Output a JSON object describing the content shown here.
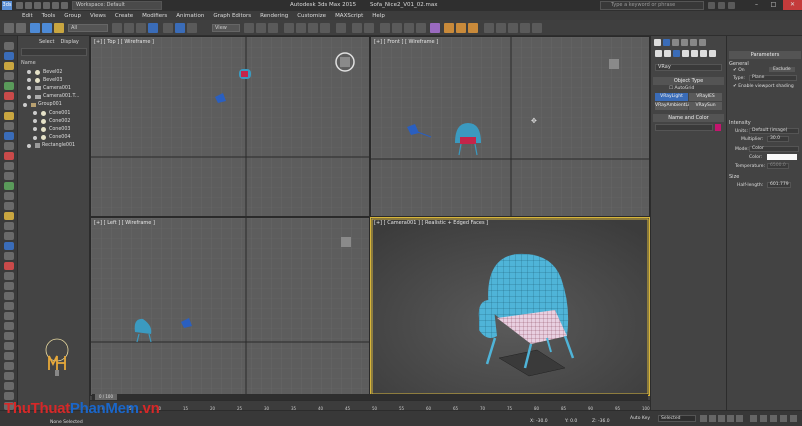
{
  "titlebar": {
    "app_logo": "3ds",
    "workspace": "Workspace: Default",
    "app_title": "Autodesk 3ds Max  2015",
    "file_title": "Sofa_Nice2_V01_02.max",
    "search_placeholder": "Type a keyword or phrase",
    "minimize": "–",
    "maximize": "□",
    "close": "✕"
  },
  "menu": [
    "Edit",
    "Tools",
    "Group",
    "Views",
    "Create",
    "Modifiers",
    "Animation",
    "Graph Editors",
    "Rendering",
    "Customize",
    "MAXScript",
    "Help"
  ],
  "toolbar": {
    "selection_filter": "All",
    "ref_coord": "View"
  },
  "scene_explorer": {
    "tabs": [
      "Select",
      "Display"
    ],
    "header": "Name",
    "items": [
      {
        "name": "Bevel02",
        "type": "light"
      },
      {
        "name": "Bevel03",
        "type": "light"
      },
      {
        "name": "Camera001",
        "type": "camera"
      },
      {
        "name": "Camera001.T...",
        "type": "camera"
      },
      {
        "name": "Group001",
        "type": "group"
      },
      {
        "name": "Cone001",
        "type": "light"
      },
      {
        "name": "Cone002",
        "type": "light"
      },
      {
        "name": "Cone003",
        "type": "light"
      },
      {
        "name": "Cone004",
        "type": "light"
      },
      {
        "name": "Rectangle001",
        "type": "object"
      }
    ]
  },
  "viewports": {
    "top": "[+] [ Top ] [ Wireframe ]",
    "front": "[+] [ Front ] [ Wireframe ]",
    "left": "[+] [ Left ] [ Wireframe ]",
    "camera": "[+] [ Camera001 ] [ Realistic + Edged Faces ]"
  },
  "command_panel": {
    "category": "VRay",
    "object_type_title": "Object Type",
    "autogrid": "AutoGrid",
    "buttons": [
      "VRayLight",
      "VRayIES",
      "VRayAmbientLig",
      "VRaySun"
    ],
    "name_color_title": "Name and Color",
    "colors": {
      "swatch": "#c4156e",
      "selected": "#3a6cb8",
      "frame": "#d8b63a"
    }
  },
  "parameters": {
    "title": "Parameters",
    "general": "General",
    "on_label": "On",
    "exclude": "Exclude",
    "type_label": "Type:",
    "type_value": "Plane",
    "viewport_shading": "Enable viewport shading",
    "intensity": "Intensity",
    "units_label": "Units:",
    "units_value": "Default (image)",
    "multiplier_label": "Multiplier:",
    "multiplier_value": "30.0",
    "mode_label": "Mode:",
    "mode_value": "Color",
    "color_label": "Color:",
    "temperature_label": "Temperature:",
    "temperature_value": "6500.0",
    "size": "Size",
    "half_length_label": "Half-length:",
    "half_length_value": "601.779"
  },
  "timeline": {
    "frame": "0 / 100",
    "ticks": [
      "0",
      "5",
      "10",
      "15",
      "20",
      "25",
      "30",
      "35",
      "40",
      "45",
      "50",
      "55",
      "60",
      "65",
      "70",
      "75",
      "80",
      "85",
      "90",
      "95",
      "100"
    ]
  },
  "status": {
    "selected": "None Selected",
    "x": "X: -30.0",
    "y": "Y: 0.0",
    "z": "Z: -36.0",
    "autokey": "Auto Key",
    "selection": "Selected"
  },
  "watermark": {
    "part1": "ThuThuat",
    "part2": "PhanMem",
    "part3": ".vn"
  }
}
